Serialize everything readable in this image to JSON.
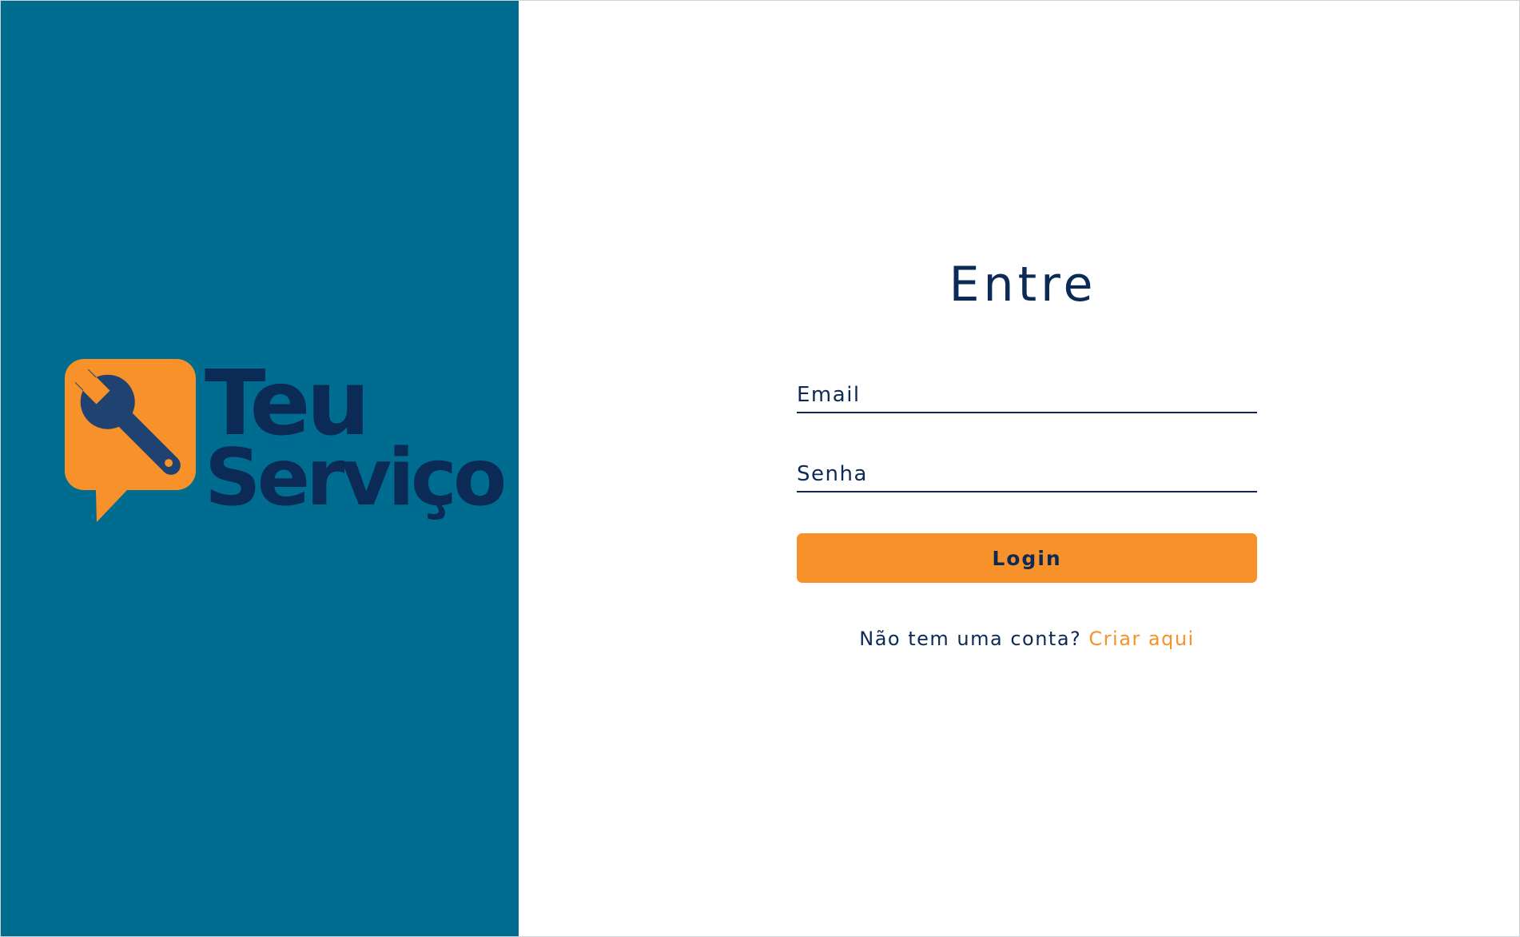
{
  "brand": {
    "name_line1": "Teu",
    "name_line2": "Serviço",
    "logo_icon": "wrench-in-speech-bubble-icon",
    "colors": {
      "panel": "#006d90",
      "navy": "#0b2a55",
      "orange": "#f7912a"
    }
  },
  "login": {
    "title": "Entre",
    "email_placeholder": "Email",
    "password_placeholder": "Senha",
    "submit_label": "Login",
    "signup_prompt": "Não tem uma conta?",
    "signup_link": "Criar aqui"
  }
}
